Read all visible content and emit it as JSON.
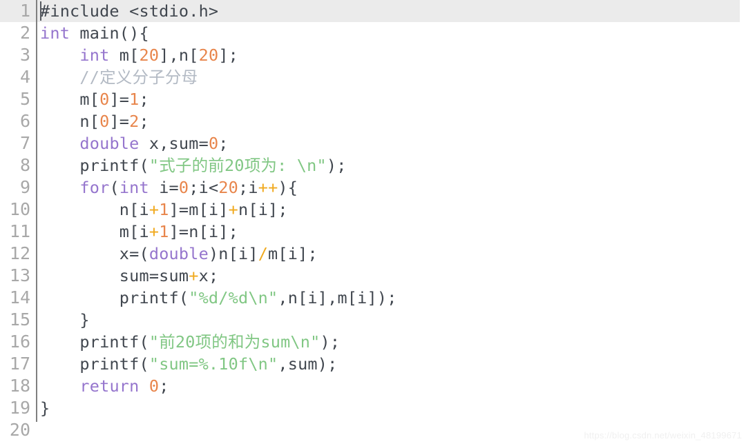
{
  "editor": {
    "language": "c",
    "total_lines": 20,
    "active_line": 1,
    "background_color": "#ffffff",
    "active_line_color": "#ebebeb",
    "gutter_number_color": "#a8a8a8",
    "gutter_divider_color": "#808080",
    "default_text_color": "#41474f",
    "theme_colors": {
      "keyword": "#9575cd",
      "number": "#e8854b",
      "string": "#81c784",
      "comment": "#b3bac4",
      "operator": "#f0a91e",
      "plain": "#41474f"
    },
    "line_numbers": [
      "1",
      "2",
      "3",
      "4",
      "5",
      "6",
      "7",
      "8",
      "9",
      "10",
      "11",
      "12",
      "13",
      "14",
      "15",
      "16",
      "17",
      "18",
      "19",
      "20"
    ],
    "lines": [
      {
        "n": "1",
        "tokens": [
          {
            "t": "#include <stdio.h>",
            "c": "txt"
          }
        ]
      },
      {
        "n": "2",
        "tokens": [
          {
            "t": "int",
            "c": "kw"
          },
          {
            "t": " main(){",
            "c": "txt"
          }
        ]
      },
      {
        "n": "3",
        "tokens": [
          {
            "t": "    ",
            "c": "txt"
          },
          {
            "t": "int",
            "c": "kw"
          },
          {
            "t": " m[",
            "c": "txt"
          },
          {
            "t": "20",
            "c": "num"
          },
          {
            "t": "],n[",
            "c": "txt"
          },
          {
            "t": "20",
            "c": "num"
          },
          {
            "t": "];",
            "c": "txt"
          }
        ]
      },
      {
        "n": "4",
        "tokens": [
          {
            "t": "    ",
            "c": "txt"
          },
          {
            "t": "//定义分子分母",
            "c": "cmt"
          }
        ]
      },
      {
        "n": "5",
        "tokens": [
          {
            "t": "    m[",
            "c": "txt"
          },
          {
            "t": "0",
            "c": "num"
          },
          {
            "t": "]=",
            "c": "txt"
          },
          {
            "t": "1",
            "c": "num"
          },
          {
            "t": ";",
            "c": "txt"
          }
        ]
      },
      {
        "n": "6",
        "tokens": [
          {
            "t": "    n[",
            "c": "txt"
          },
          {
            "t": "0",
            "c": "num"
          },
          {
            "t": "]=",
            "c": "txt"
          },
          {
            "t": "2",
            "c": "num"
          },
          {
            "t": ";",
            "c": "txt"
          }
        ]
      },
      {
        "n": "7",
        "tokens": [
          {
            "t": "    ",
            "c": "txt"
          },
          {
            "t": "double",
            "c": "kw"
          },
          {
            "t": " x,sum=",
            "c": "txt"
          },
          {
            "t": "0",
            "c": "num"
          },
          {
            "t": ";",
            "c": "txt"
          }
        ]
      },
      {
        "n": "8",
        "tokens": [
          {
            "t": "    printf(",
            "c": "txt"
          },
          {
            "t": "\"式子的前20项为: \\n\"",
            "c": "str"
          },
          {
            "t": ");",
            "c": "txt"
          }
        ]
      },
      {
        "n": "9",
        "tokens": [
          {
            "t": "    ",
            "c": "txt"
          },
          {
            "t": "for",
            "c": "kw"
          },
          {
            "t": "(",
            "c": "txt"
          },
          {
            "t": "int",
            "c": "kw"
          },
          {
            "t": " i=",
            "c": "txt"
          },
          {
            "t": "0",
            "c": "num"
          },
          {
            "t": ";i<",
            "c": "txt"
          },
          {
            "t": "20",
            "c": "num"
          },
          {
            "t": ";i",
            "c": "txt"
          },
          {
            "t": "++",
            "c": "op"
          },
          {
            "t": "){",
            "c": "txt"
          }
        ]
      },
      {
        "n": "10",
        "tokens": [
          {
            "t": "        n[i",
            "c": "txt"
          },
          {
            "t": "+",
            "c": "op"
          },
          {
            "t": "1",
            "c": "num"
          },
          {
            "t": "]=m[i]",
            "c": "txt"
          },
          {
            "t": "+",
            "c": "op"
          },
          {
            "t": "n[i];",
            "c": "txt"
          }
        ]
      },
      {
        "n": "11",
        "tokens": [
          {
            "t": "        m[i",
            "c": "txt"
          },
          {
            "t": "+",
            "c": "op"
          },
          {
            "t": "1",
            "c": "num"
          },
          {
            "t": "]=n[i];",
            "c": "txt"
          }
        ]
      },
      {
        "n": "12",
        "tokens": [
          {
            "t": "        x=(",
            "c": "txt"
          },
          {
            "t": "double",
            "c": "kw"
          },
          {
            "t": ")n[i]",
            "c": "txt"
          },
          {
            "t": "/",
            "c": "op"
          },
          {
            "t": "m[i];",
            "c": "txt"
          }
        ]
      },
      {
        "n": "13",
        "tokens": [
          {
            "t": "        sum=sum",
            "c": "txt"
          },
          {
            "t": "+",
            "c": "op"
          },
          {
            "t": "x;",
            "c": "txt"
          }
        ]
      },
      {
        "n": "14",
        "tokens": [
          {
            "t": "        printf(",
            "c": "txt"
          },
          {
            "t": "\"%d/%d\\n\"",
            "c": "str"
          },
          {
            "t": ",n[i],m[i]);",
            "c": "txt"
          }
        ]
      },
      {
        "n": "15",
        "tokens": [
          {
            "t": "    }",
            "c": "txt"
          }
        ]
      },
      {
        "n": "16",
        "tokens": [
          {
            "t": "    printf(",
            "c": "txt"
          },
          {
            "t": "\"前20项的和为sum\\n\"",
            "c": "str"
          },
          {
            "t": ");",
            "c": "txt"
          }
        ]
      },
      {
        "n": "17",
        "tokens": [
          {
            "t": "    printf(",
            "c": "txt"
          },
          {
            "t": "\"sum=%.10f\\n\"",
            "c": "str"
          },
          {
            "t": ",sum);",
            "c": "txt"
          }
        ]
      },
      {
        "n": "18",
        "tokens": [
          {
            "t": "    ",
            "c": "txt"
          },
          {
            "t": "return",
            "c": "kw"
          },
          {
            "t": " ",
            "c": "txt"
          },
          {
            "t": "0",
            "c": "num"
          },
          {
            "t": ";",
            "c": "txt"
          }
        ]
      },
      {
        "n": "19",
        "tokens": [
          {
            "t": "}",
            "c": "txt"
          }
        ]
      },
      {
        "n": "20",
        "tokens": []
      }
    ]
  },
  "watermark": {
    "text": "https://blog.csdn.net/weixin_48199671"
  }
}
